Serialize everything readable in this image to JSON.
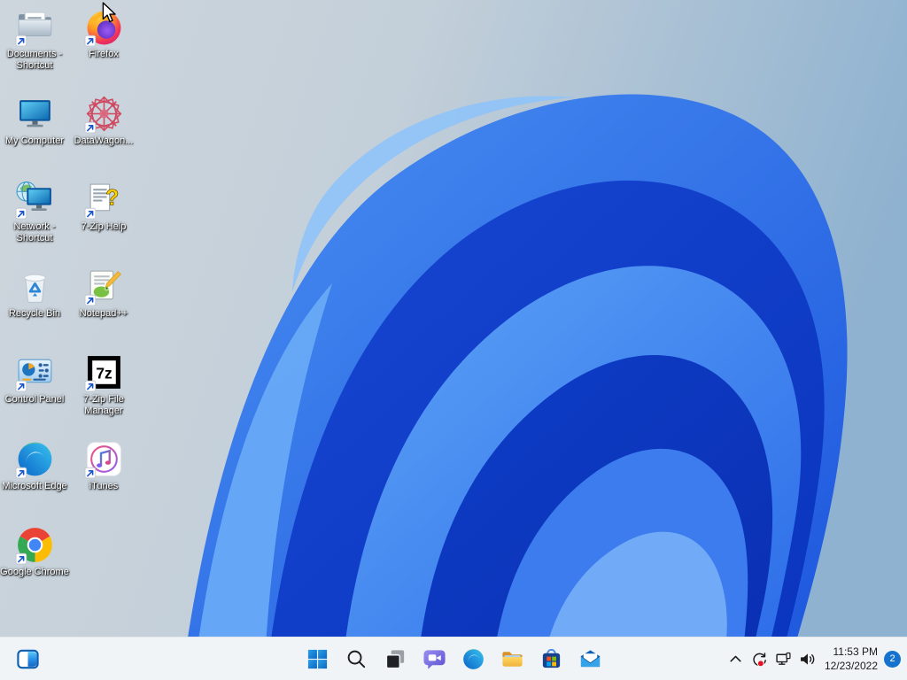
{
  "desktop": {
    "icons": [
      {
        "label": "Documents - Shortcut",
        "icon": "documents-folder",
        "col": 0,
        "row": 0,
        "shortcut": true
      },
      {
        "label": "Firefox",
        "icon": "firefox",
        "col": 1,
        "row": 0,
        "shortcut": true
      },
      {
        "label": "My Computer",
        "icon": "my-computer",
        "col": 0,
        "row": 1,
        "shortcut": false
      },
      {
        "label": "DataWagon...",
        "icon": "datawagon",
        "col": 1,
        "row": 1,
        "shortcut": true
      },
      {
        "label": "Network - Shortcut",
        "icon": "network",
        "col": 0,
        "row": 2,
        "shortcut": true
      },
      {
        "label": "7-Zip Help",
        "icon": "seven-zip-help",
        "col": 1,
        "row": 2,
        "shortcut": true
      },
      {
        "label": "Recycle Bin",
        "icon": "recycle-bin",
        "col": 0,
        "row": 3,
        "shortcut": false
      },
      {
        "label": "Notepad++",
        "icon": "notepad-plus-plus",
        "col": 1,
        "row": 3,
        "shortcut": true
      },
      {
        "label": "Control Panel",
        "icon": "control-panel",
        "col": 0,
        "row": 4,
        "shortcut": true
      },
      {
        "label": "7-Zip File Manager",
        "icon": "seven-zip-file-manager",
        "col": 1,
        "row": 4,
        "shortcut": true
      },
      {
        "label": "Microsoft Edge",
        "icon": "microsoft-edge",
        "col": 0,
        "row": 5,
        "shortcut": true
      },
      {
        "label": "iTunes",
        "icon": "itunes",
        "col": 1,
        "row": 5,
        "shortcut": true
      },
      {
        "label": "Google Chrome",
        "icon": "google-chrome",
        "col": 0,
        "row": 6,
        "shortcut": true
      }
    ]
  },
  "taskbar": {
    "widgets_button": {
      "name": "widgets"
    },
    "center_items": [
      {
        "name": "start"
      },
      {
        "name": "search"
      },
      {
        "name": "task-view"
      },
      {
        "name": "chat"
      },
      {
        "name": "microsoft-edge"
      },
      {
        "name": "file-explorer"
      },
      {
        "name": "microsoft-store"
      },
      {
        "name": "mail"
      }
    ],
    "tray": {
      "items": [
        {
          "name": "hidden-icons-chevron"
        },
        {
          "name": "windows-update"
        },
        {
          "name": "network"
        },
        {
          "name": "volume"
        }
      ],
      "clock": {
        "time": "11:53 PM",
        "date": "12/23/2022"
      },
      "notification_badge": "2"
    }
  },
  "colors": {
    "taskbar_bg": "#f1f4f7",
    "badge_blue": "#1573cf",
    "update_dot_red": "#e81123",
    "sky_left": "#ced6dd",
    "sky_right": "#8fb2d0",
    "bloom_light": "#6fb0f8",
    "bloom_mid": "#2a6ae8",
    "bloom_deep": "#0a34bd"
  }
}
